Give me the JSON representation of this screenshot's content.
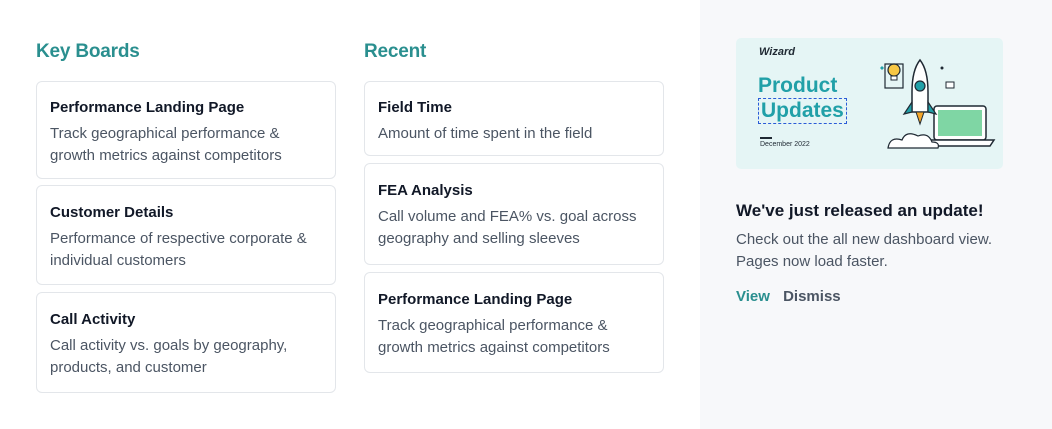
{
  "key_boards": {
    "title": "Key Boards",
    "cards": [
      {
        "title": "Performance Landing Page",
        "description": "Track geographical performance & growth metrics against competitors"
      },
      {
        "title": "Customer Details",
        "description": "Performance of respective corporate & individual customers"
      },
      {
        "title": "Call Activity",
        "description": "Call activity vs. goals by geography, products, and customer"
      }
    ]
  },
  "recent": {
    "title": "Recent",
    "cards": [
      {
        "title": "Field Time",
        "description": "Amount of time spent in the field"
      },
      {
        "title": "FEA Analysis",
        "description": "Call volume and FEA%  vs. goal across geography and selling sleeves"
      },
      {
        "title": "Performance Landing Page",
        "description": "Track geographical performance & growth metrics against competitors"
      }
    ]
  },
  "promo": {
    "brand": "Wizard",
    "title_line1": "Product",
    "title_line2": "Updates",
    "date": "December 2022"
  },
  "update": {
    "title": "We've just released an update!",
    "description": "Check out the all new dashboard view. Pages now load faster.",
    "view_label": "View",
    "dismiss_label": "Dismiss"
  },
  "colors": {
    "accent": "#2a8f8f",
    "panel_bg": "#f7f8fa",
    "promo_bg": "#e5f5f5"
  }
}
